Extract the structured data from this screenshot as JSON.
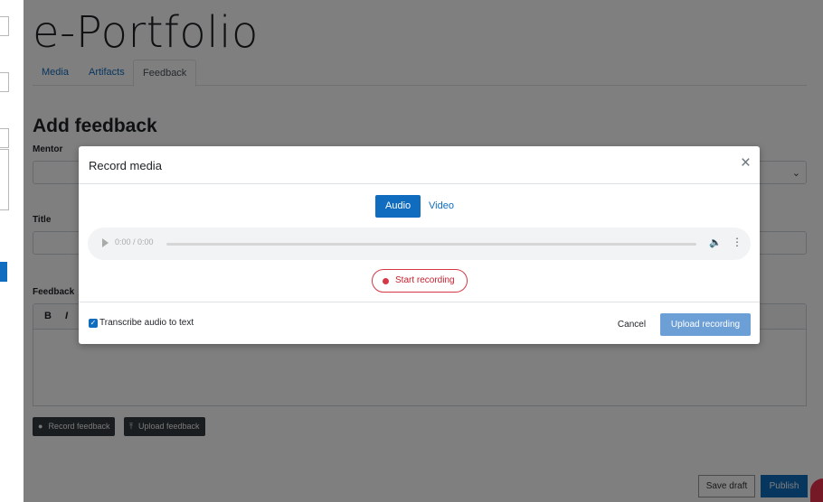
{
  "page": {
    "title": "e-Portfolio",
    "tabs": [
      {
        "label": "Media"
      },
      {
        "label": "Artifacts"
      },
      {
        "label": "Feedback",
        "active": true
      }
    ],
    "section_title": "Add feedback",
    "fields": {
      "mentor_label": "Mentor",
      "title_label": "Title",
      "feedback_label": "Feedback",
      "toolbar_bold": "B",
      "toolbar_italic": "I"
    },
    "actions": {
      "record_feedback": "Record feedback",
      "upload_feedback": "Upload feedback",
      "save_draft": "Save draft",
      "publish": "Publish"
    }
  },
  "modal": {
    "title": "Record media",
    "close_glyph": "×",
    "segments": [
      {
        "label": "Audio",
        "active": true
      },
      {
        "label": "Video",
        "active": false
      }
    ],
    "player": {
      "time": "0:00 / 0:00",
      "progress": 0.0
    },
    "start_recording": "Start recording",
    "transcribe_label": "Transcribe audio to text",
    "transcribe_checked": true,
    "cancel": "Cancel",
    "upload_recording": "Upload recording"
  },
  "colors": {
    "brand_blue": "#0f6cbf",
    "record_red": "#d63746",
    "overlay": "rgba(0,0,0,0.5)"
  }
}
